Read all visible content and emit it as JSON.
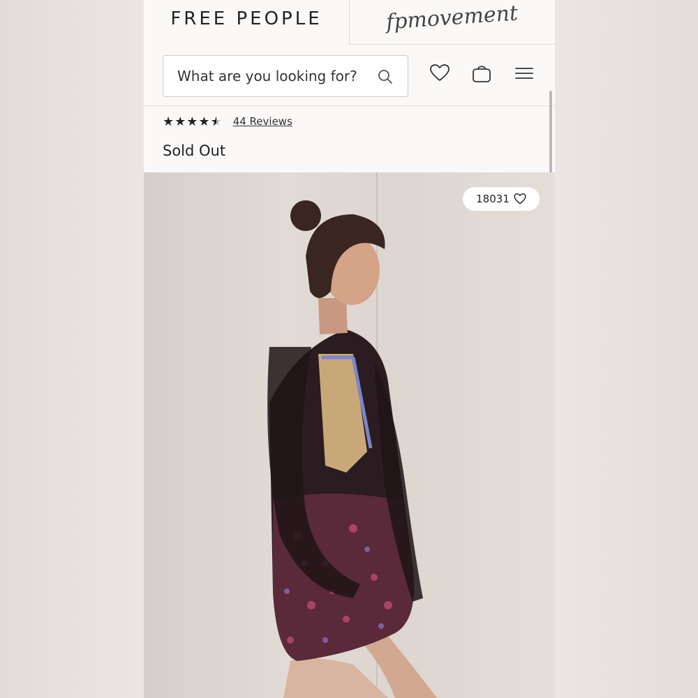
{
  "header": {
    "brand_primary": "FREE PEOPLE",
    "brand_secondary": "fpmovement"
  },
  "search": {
    "placeholder": "What are you looking for?"
  },
  "icons": {
    "search": "search-icon",
    "wishlist": "heart-icon",
    "bag": "shopping-bag-icon",
    "menu": "hamburger-menu-icon"
  },
  "product": {
    "rating": 4.5,
    "rating_max": 5,
    "reviews_label": "44 Reviews",
    "availability": "Sold Out",
    "favorites_count": "18031"
  },
  "colors": {
    "page_background": "#fbf9f8",
    "text": "#222222",
    "border": "#cfcac7"
  }
}
